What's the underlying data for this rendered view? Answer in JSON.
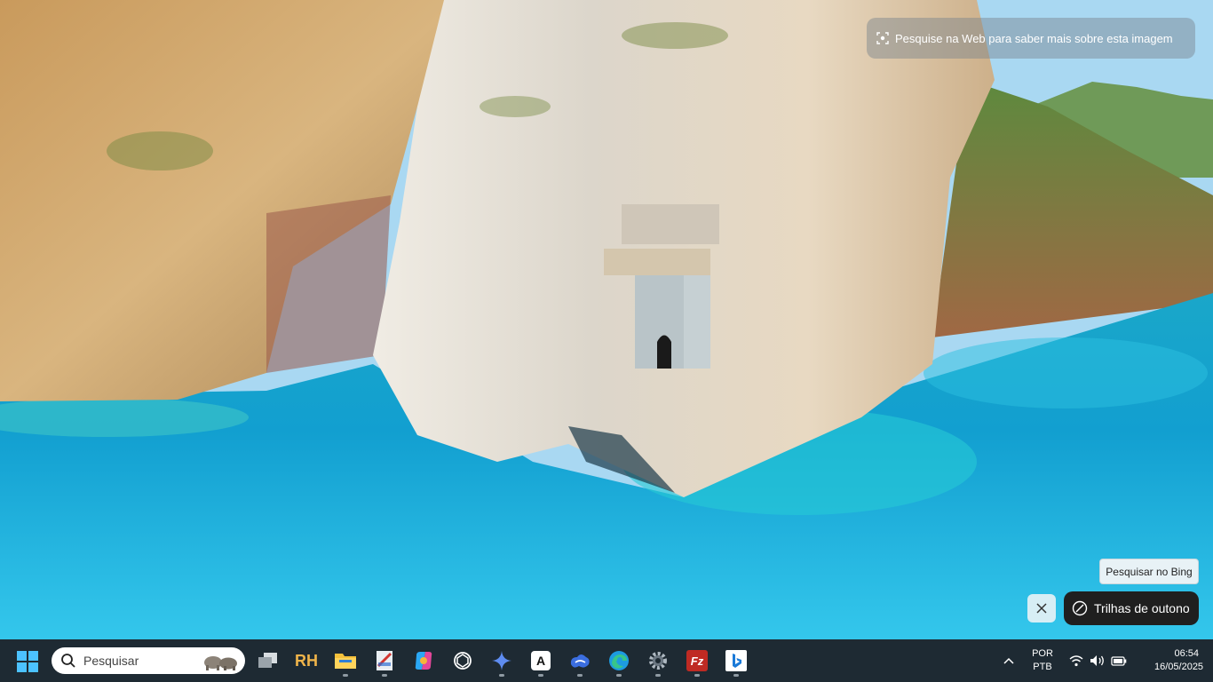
{
  "overlay": {
    "web_search_text": "Pesquise na Web para saber mais sobre esta imagem",
    "bing_tooltip": "Pesquisar no Bing",
    "trail_chip_label": "Trilhas de outono"
  },
  "taskbar": {
    "search_placeholder": "Pesquisar",
    "apps": [
      {
        "name": "task-view",
        "label": ""
      },
      {
        "name": "rh-app",
        "label": "RH"
      },
      {
        "name": "file-explorer",
        "label": ""
      },
      {
        "name": "paint-app",
        "label": ""
      },
      {
        "name": "copilot",
        "label": ""
      },
      {
        "name": "chatgpt",
        "label": ""
      },
      {
        "name": "gemini",
        "label": ""
      },
      {
        "name": "a-app",
        "label": "A"
      },
      {
        "name": "cloud-app",
        "label": ""
      },
      {
        "name": "edge",
        "label": ""
      },
      {
        "name": "settings",
        "label": ""
      },
      {
        "name": "filezilla",
        "label": "Fz"
      },
      {
        "name": "bing",
        "label": ""
      }
    ],
    "language_top": "POR",
    "language_bottom": "PTB",
    "time": "06:54",
    "date": "16/05/2025"
  }
}
